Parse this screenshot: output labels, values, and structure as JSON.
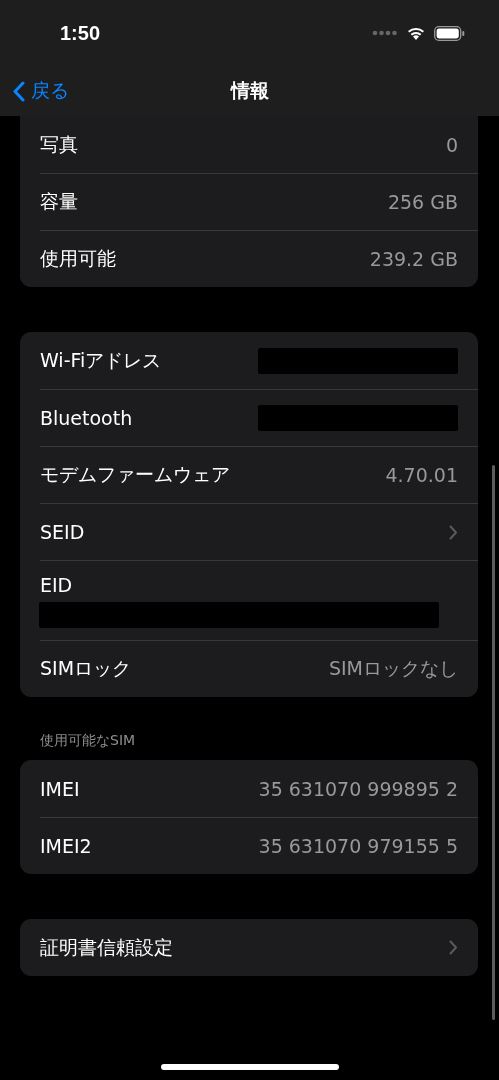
{
  "status_bar": {
    "time": "1:50"
  },
  "nav": {
    "back": "戻る",
    "title": "情報"
  },
  "groups": [
    {
      "cut_top": true,
      "rows": [
        {
          "kind": "value",
          "label": "写真",
          "value": "0"
        },
        {
          "kind": "value",
          "label": "容量",
          "value": "256 GB"
        },
        {
          "kind": "value",
          "label": "使用可能",
          "value": "239.2 GB"
        }
      ]
    },
    {
      "cut_top": false,
      "rows": [
        {
          "kind": "redacted",
          "label": "Wi-Fiアドレス"
        },
        {
          "kind": "redacted",
          "label": "Bluetooth"
        },
        {
          "kind": "value",
          "label": "モデムファームウェア",
          "value": "4.70.01"
        },
        {
          "kind": "link",
          "label": "SEID"
        },
        {
          "kind": "redacted_below",
          "label": "EID"
        },
        {
          "kind": "value",
          "label": "SIMロック",
          "value": "SIMロックなし"
        }
      ]
    },
    {
      "cut_top": false,
      "header": "使用可能なSIM",
      "rows": [
        {
          "kind": "value",
          "label": "IMEI",
          "value": "35 631070 999895 2"
        },
        {
          "kind": "value",
          "label": "IMEI2",
          "value": "35 631070 979155 5"
        }
      ]
    },
    {
      "cut_top": false,
      "rows": [
        {
          "kind": "link",
          "label": "証明書信頼設定"
        }
      ]
    }
  ]
}
